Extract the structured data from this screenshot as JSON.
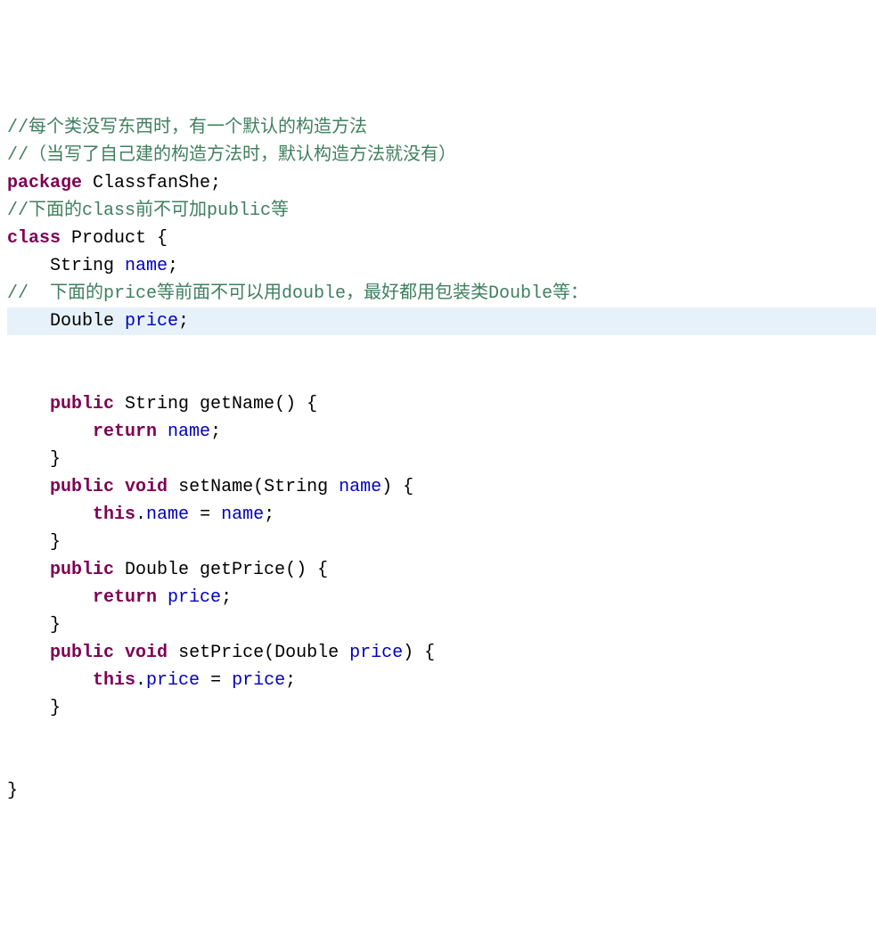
{
  "code": {
    "lines": [
      {
        "highlight": false,
        "tokens": [
          {
            "cls": "tok-comment",
            "text": "//每个类没写东西时，有一个默认的构造方法"
          }
        ]
      },
      {
        "highlight": false,
        "tokens": [
          {
            "cls": "tok-comment",
            "text": "//（当写了自己建的构造方法时，默认构造方法就没有）"
          }
        ]
      },
      {
        "highlight": false,
        "tokens": [
          {
            "cls": "tok-keyword",
            "text": "package"
          },
          {
            "cls": "tok-ident",
            "text": " ClassfanShe"
          },
          {
            "cls": "tok-punct",
            "text": ";"
          }
        ]
      },
      {
        "highlight": false,
        "tokens": [
          {
            "cls": "tok-comment",
            "text": "//下面的class前不可加public等"
          }
        ]
      },
      {
        "highlight": false,
        "tokens": [
          {
            "cls": "tok-keyword",
            "text": "class"
          },
          {
            "cls": "tok-ident",
            "text": " Product "
          },
          {
            "cls": "tok-punct",
            "text": "{"
          }
        ]
      },
      {
        "highlight": false,
        "tokens": [
          {
            "cls": "tok-ident",
            "text": "    String "
          },
          {
            "cls": "tok-field",
            "text": "name"
          },
          {
            "cls": "tok-punct",
            "text": ";"
          }
        ]
      },
      {
        "highlight": false,
        "tokens": [
          {
            "cls": "tok-comment",
            "text": "//  下面的price等前面不可以用double，最好都用包装类Double等："
          }
        ]
      },
      {
        "highlight": true,
        "tokens": [
          {
            "cls": "tok-ident",
            "text": "    Double "
          },
          {
            "cls": "tok-field",
            "text": "price"
          },
          {
            "cls": "tok-punct",
            "text": ";"
          }
        ]
      },
      {
        "highlight": false,
        "tokens": []
      },
      {
        "highlight": false,
        "tokens": []
      },
      {
        "highlight": false,
        "tokens": [
          {
            "cls": "tok-ident",
            "text": "    "
          },
          {
            "cls": "tok-keyword",
            "text": "public"
          },
          {
            "cls": "tok-ident",
            "text": " String getName"
          },
          {
            "cls": "tok-punct",
            "text": "() {"
          }
        ]
      },
      {
        "highlight": false,
        "tokens": [
          {
            "cls": "tok-ident",
            "text": "        "
          },
          {
            "cls": "tok-keyword",
            "text": "return"
          },
          {
            "cls": "tok-ident",
            "text": " "
          },
          {
            "cls": "tok-field",
            "text": "name"
          },
          {
            "cls": "tok-punct",
            "text": ";"
          }
        ]
      },
      {
        "highlight": false,
        "tokens": [
          {
            "cls": "tok-punct",
            "text": "    }"
          }
        ]
      },
      {
        "highlight": false,
        "tokens": [
          {
            "cls": "tok-ident",
            "text": "    "
          },
          {
            "cls": "tok-keyword",
            "text": "public"
          },
          {
            "cls": "tok-ident",
            "text": " "
          },
          {
            "cls": "tok-keyword",
            "text": "void"
          },
          {
            "cls": "tok-ident",
            "text": " setName"
          },
          {
            "cls": "tok-punct",
            "text": "("
          },
          {
            "cls": "tok-ident",
            "text": "String "
          },
          {
            "cls": "tok-field",
            "text": "name"
          },
          {
            "cls": "tok-punct",
            "text": ") {"
          }
        ]
      },
      {
        "highlight": false,
        "tokens": [
          {
            "cls": "tok-ident",
            "text": "        "
          },
          {
            "cls": "tok-keyword",
            "text": "this"
          },
          {
            "cls": "tok-punct",
            "text": "."
          },
          {
            "cls": "tok-field",
            "text": "name"
          },
          {
            "cls": "tok-ident",
            "text": " = "
          },
          {
            "cls": "tok-field",
            "text": "name"
          },
          {
            "cls": "tok-punct",
            "text": ";"
          }
        ]
      },
      {
        "highlight": false,
        "tokens": [
          {
            "cls": "tok-punct",
            "text": "    }"
          }
        ]
      },
      {
        "highlight": false,
        "tokens": [
          {
            "cls": "tok-ident",
            "text": "    "
          },
          {
            "cls": "tok-keyword",
            "text": "public"
          },
          {
            "cls": "tok-ident",
            "text": " Double getPrice"
          },
          {
            "cls": "tok-punct",
            "text": "() {"
          }
        ]
      },
      {
        "highlight": false,
        "tokens": [
          {
            "cls": "tok-ident",
            "text": "        "
          },
          {
            "cls": "tok-keyword",
            "text": "return"
          },
          {
            "cls": "tok-ident",
            "text": " "
          },
          {
            "cls": "tok-field",
            "text": "price"
          },
          {
            "cls": "tok-punct",
            "text": ";"
          }
        ]
      },
      {
        "highlight": false,
        "tokens": [
          {
            "cls": "tok-punct",
            "text": "    }"
          }
        ]
      },
      {
        "highlight": false,
        "tokens": [
          {
            "cls": "tok-ident",
            "text": "    "
          },
          {
            "cls": "tok-keyword",
            "text": "public"
          },
          {
            "cls": "tok-ident",
            "text": " "
          },
          {
            "cls": "tok-keyword",
            "text": "void"
          },
          {
            "cls": "tok-ident",
            "text": " setPrice"
          },
          {
            "cls": "tok-punct",
            "text": "("
          },
          {
            "cls": "tok-ident",
            "text": "Double "
          },
          {
            "cls": "tok-field",
            "text": "price"
          },
          {
            "cls": "tok-punct",
            "text": ") {"
          }
        ]
      },
      {
        "highlight": false,
        "tokens": [
          {
            "cls": "tok-ident",
            "text": "        "
          },
          {
            "cls": "tok-keyword",
            "text": "this"
          },
          {
            "cls": "tok-punct",
            "text": "."
          },
          {
            "cls": "tok-field",
            "text": "price"
          },
          {
            "cls": "tok-ident",
            "text": " = "
          },
          {
            "cls": "tok-field",
            "text": "price"
          },
          {
            "cls": "tok-punct",
            "text": ";"
          }
        ]
      },
      {
        "highlight": false,
        "tokens": [
          {
            "cls": "tok-punct",
            "text": "    }"
          }
        ]
      },
      {
        "highlight": false,
        "tokens": []
      },
      {
        "highlight": false,
        "tokens": []
      },
      {
        "highlight": false,
        "tokens": [
          {
            "cls": "tok-punct",
            "text": "}"
          }
        ]
      }
    ]
  }
}
